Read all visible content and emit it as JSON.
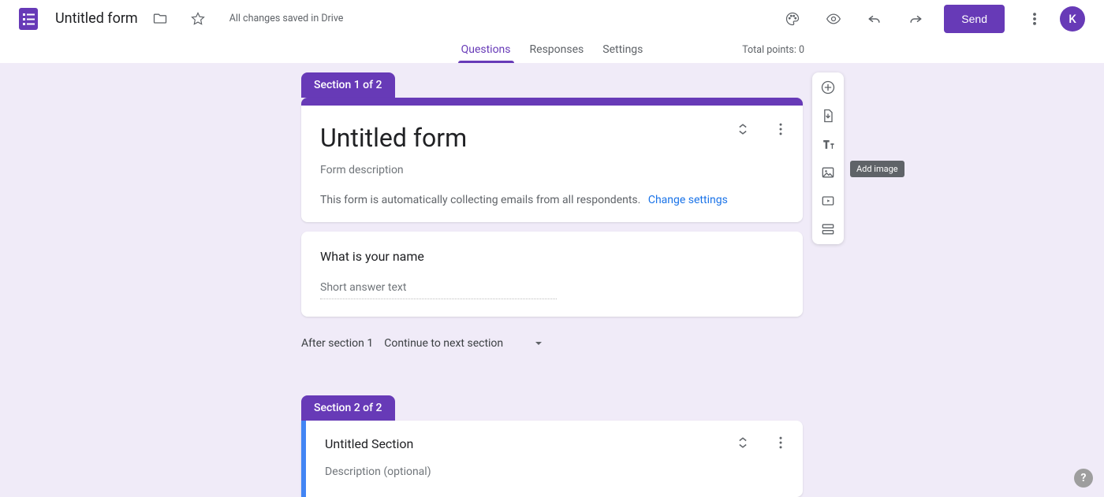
{
  "header": {
    "doc_title": "Untitled form",
    "save_status": "All changes saved in Drive",
    "send_label": "Send",
    "avatar_initial": "K",
    "total_points": "Total points: 0",
    "tabs": {
      "questions": "Questions",
      "responses": "Responses",
      "settings": "Settings"
    }
  },
  "section1": {
    "badge": "Section 1 of 2",
    "form_title": "Untitled form",
    "form_description_placeholder": "Form description",
    "info_text": "This form is automatically collecting emails from all respondents.",
    "change_link": "Change settings",
    "question": {
      "title": "What is your name",
      "answer_placeholder": "Short answer text"
    },
    "after_label": "After section 1",
    "after_value": "Continue to next section"
  },
  "section2": {
    "badge": "Section 2 of 2",
    "title": "Untitled Section",
    "description_placeholder": "Description (optional)"
  },
  "tooltip": {
    "add_image": "Add image"
  },
  "help": "?"
}
